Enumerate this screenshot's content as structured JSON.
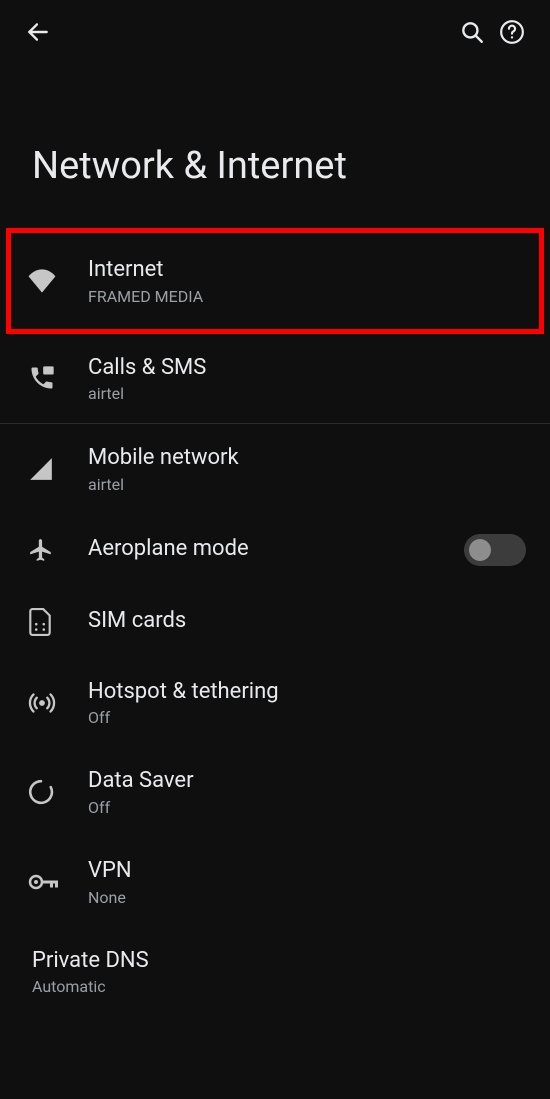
{
  "header": {
    "title": "Network & Internet"
  },
  "items": {
    "internet": {
      "label": "Internet",
      "sub": "FRAMED MEDIA",
      "highlighted": true
    },
    "calls_sms": {
      "label": "Calls & SMS",
      "sub": "airtel"
    },
    "mobile_network": {
      "label": "Mobile network",
      "sub": "airtel"
    },
    "aeroplane_mode": {
      "label": "Aeroplane mode",
      "switch": "off"
    },
    "sim_cards": {
      "label": "SIM cards"
    },
    "hotspot": {
      "label": "Hotspot & tethering",
      "sub": "Off"
    },
    "data_saver": {
      "label": "Data Saver",
      "sub": "Off"
    },
    "vpn": {
      "label": "VPN",
      "sub": "None"
    },
    "private_dns": {
      "label": "Private DNS",
      "sub": "Automatic"
    }
  }
}
